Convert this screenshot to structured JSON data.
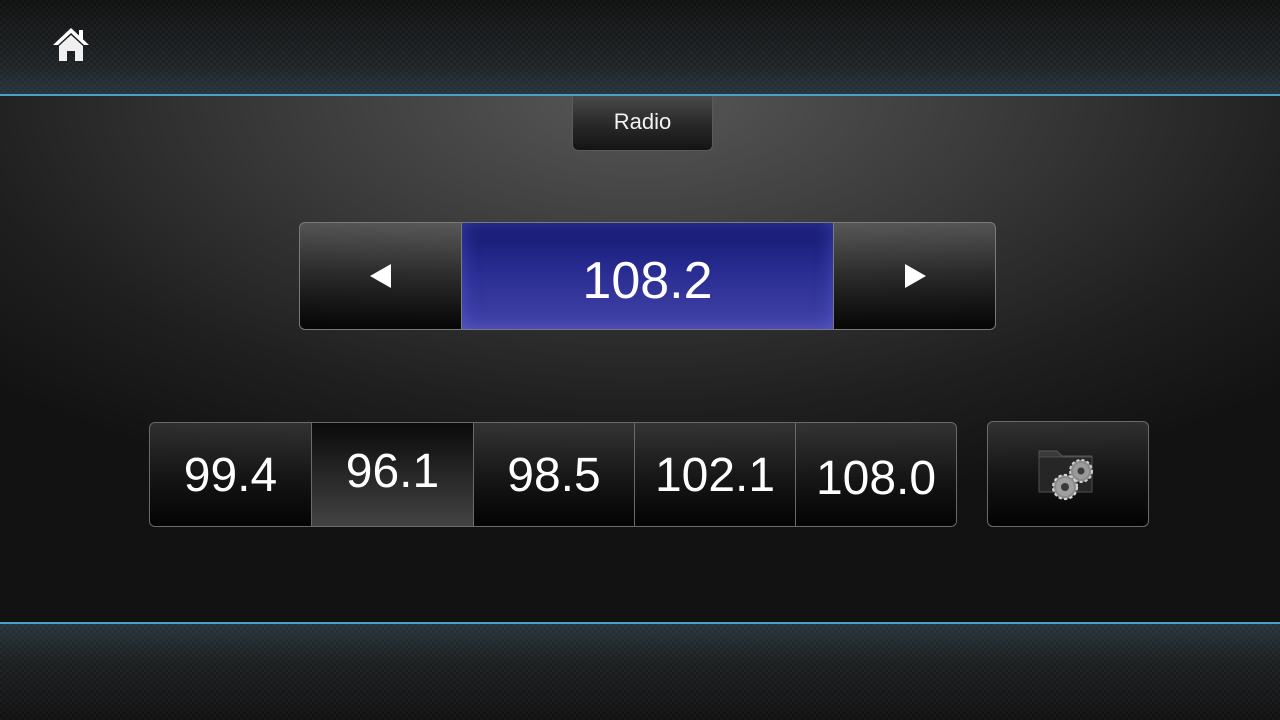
{
  "header": {
    "home_icon": "home-icon",
    "accent_color": "#4aa0c8"
  },
  "screen": {
    "title": "Radio"
  },
  "tuner": {
    "frequency": "108.2",
    "prev_icon": "triangle-left-icon",
    "next_icon": "triangle-right-icon",
    "display_color": "#262a8e"
  },
  "presets": [
    {
      "label": "99.4",
      "active": false
    },
    {
      "label": "96.1",
      "active": true
    },
    {
      "label": "98.5",
      "active": false
    },
    {
      "label": "102.1",
      "active": false
    },
    {
      "label": "108.0",
      "active": false
    }
  ],
  "settings": {
    "icon": "folder-gears-icon"
  }
}
